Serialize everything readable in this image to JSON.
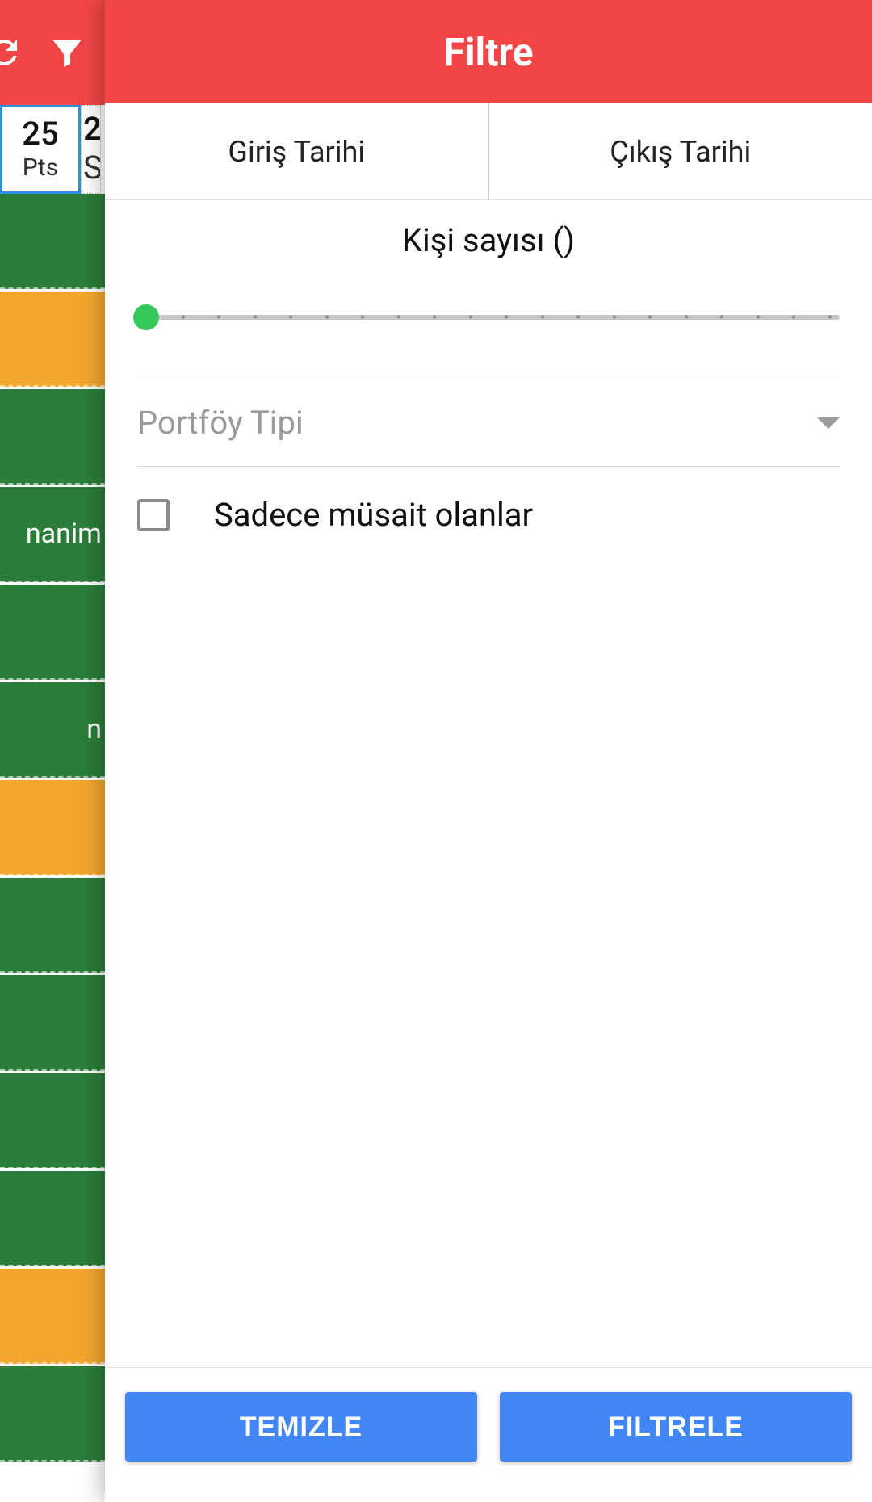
{
  "bg": {
    "icons": [
      "refresh-icon",
      "filter-icon"
    ],
    "date_cell": {
      "num": "25",
      "day": "Pts"
    },
    "date_cell2": {
      "num": "2",
      "day": "S"
    },
    "blocks": [
      {
        "color": "green",
        "label": ""
      },
      {
        "color": "orange",
        "label": ""
      },
      {
        "color": "green",
        "label": ""
      },
      {
        "color": "green",
        "label": "nanim"
      },
      {
        "color": "green",
        "label": ""
      },
      {
        "color": "green",
        "label": "n"
      },
      {
        "color": "orange",
        "label": ""
      },
      {
        "color": "green",
        "label": ""
      },
      {
        "color": "green",
        "label": ""
      },
      {
        "color": "green",
        "label": ""
      },
      {
        "color": "green",
        "label": ""
      },
      {
        "color": "orange",
        "label": ""
      },
      {
        "color": "green",
        "label": ""
      }
    ]
  },
  "drawer": {
    "title": "Filtre",
    "tab_in": "Giriş Tarihi",
    "tab_out": "Çıkış Tarihi",
    "person_label": "Kişi sayısı",
    "person_value": "",
    "slider_ticks": 20,
    "dropdown_placeholder": "Portföy Tipi",
    "checkbox_label": "Sadece müsait olanlar",
    "btn_clear": "TEMIZLE",
    "btn_apply": "FILTRELE"
  },
  "colors": {
    "primary_red": "#f24646",
    "green": "#2b7d3a",
    "orange": "#f2a72c",
    "blue": "#4285f4",
    "slider_green": "#34c759"
  }
}
